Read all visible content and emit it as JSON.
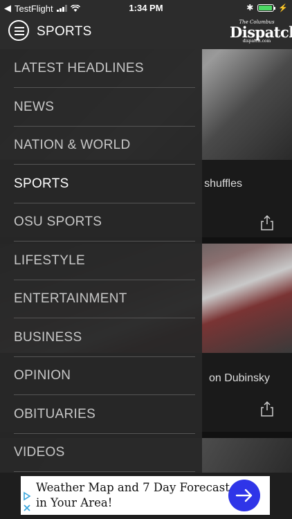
{
  "status_bar": {
    "back_app": "TestFlight",
    "time": "1:34 PM"
  },
  "nav": {
    "title": "SPORTS",
    "logo": {
      "line1": "The Columbus",
      "line2": "Dispatch",
      "line3": "dispatch.com"
    }
  },
  "menu": {
    "items": [
      {
        "label": "LATEST HEADLINES",
        "active": false
      },
      {
        "label": "NEWS",
        "active": false
      },
      {
        "label": "NATION & WORLD",
        "active": false
      },
      {
        "label": "SPORTS",
        "active": true
      },
      {
        "label": "OSU SPORTS",
        "active": false
      },
      {
        "label": "LIFESTYLE",
        "active": false
      },
      {
        "label": "ENTERTAINMENT",
        "active": false
      },
      {
        "label": "BUSINESS",
        "active": false
      },
      {
        "label": "OPINION",
        "active": false
      },
      {
        "label": "OBITUARIES",
        "active": false
      },
      {
        "label": "VIDEOS",
        "active": false
      }
    ]
  },
  "articles": [
    {
      "title_visible": "shuffles"
    },
    {
      "title_visible": "on Dubinsky"
    }
  ],
  "ad": {
    "text": "Weather Map and 7 Day Forecast in Your Area!"
  },
  "colors": {
    "accent_ad_button": "#2f35e8",
    "battery": "#4cd964",
    "drawer_bg": "#282828"
  }
}
